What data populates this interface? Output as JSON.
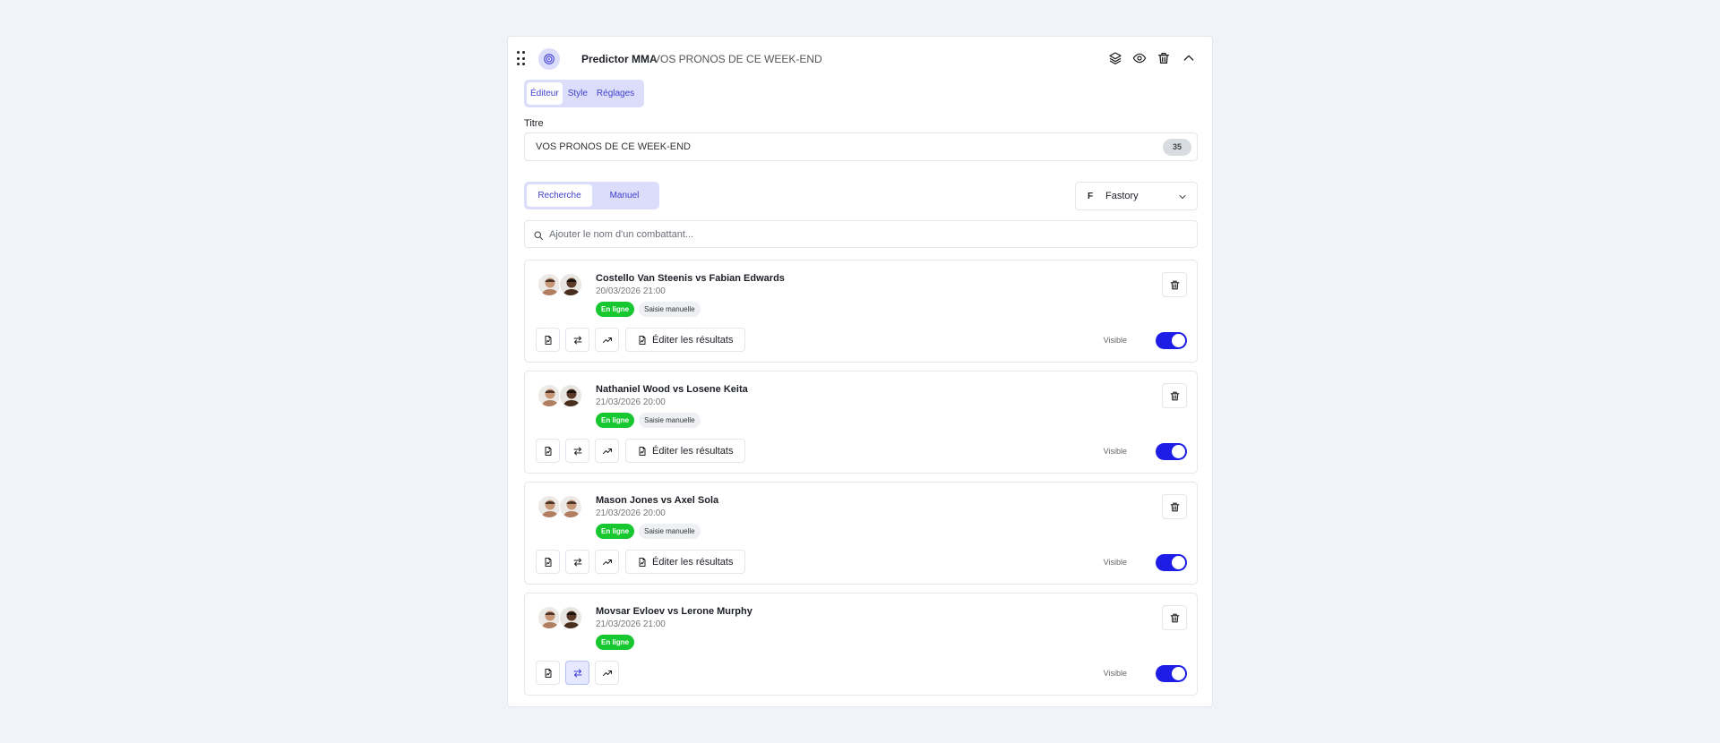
{
  "header": {
    "title": "Predictor MMA",
    "subtitle": "VOS PRONOS DE CE WEEK-END",
    "icons": [
      "drag-handle-icon",
      "plugin-icon",
      "layers-icon",
      "eye-icon",
      "trash-icon",
      "chevron-up-icon"
    ]
  },
  "tabs": [
    {
      "label": "Éditeur",
      "active": true
    },
    {
      "label": "Style",
      "active": false
    },
    {
      "label": "Réglages",
      "active": false
    }
  ],
  "title_field": {
    "label": "Titre",
    "value": "VOS PRONOS DE CE WEEK-END",
    "count": "35"
  },
  "mode": {
    "search_label": "Recherche",
    "manual_label": "Manuel"
  },
  "provider": {
    "letter": "F",
    "name": "Fastory"
  },
  "search": {
    "placeholder": "Ajouter le nom d'un combattant..."
  },
  "fights": [
    {
      "name": "Costello Van Steenis vs Fabian Edwards",
      "date": "20/03/2026 21:00",
      "status": "En ligne",
      "tag": "Saisie manuelle",
      "edit_label": "Éditer les résultats",
      "visible_label": "Visible"
    },
    {
      "name": "Nathaniel Wood vs Losene Keita",
      "date": "21/03/2026 20:00",
      "status": "En ligne",
      "tag": "Saisie manuelle",
      "edit_label": "Éditer les résultats",
      "visible_label": "Visible"
    },
    {
      "name": "Mason Jones vs Axel Sola",
      "date": "21/03/2026 20:00",
      "status": "En ligne",
      "tag": "Saisie manuelle",
      "edit_label": "Éditer les résultats",
      "visible_label": "Visible"
    },
    {
      "name": "Movsar Evloev vs Lerone Murphy",
      "date": "21/03/2026 21:00",
      "status": "En ligne",
      "visible_label": "Visible"
    }
  ],
  "colors": {
    "accent": "#1d1de6",
    "online_badge": "#16c72f",
    "tab_bg": "#dcdcfb",
    "tab_text": "#4040cc"
  }
}
